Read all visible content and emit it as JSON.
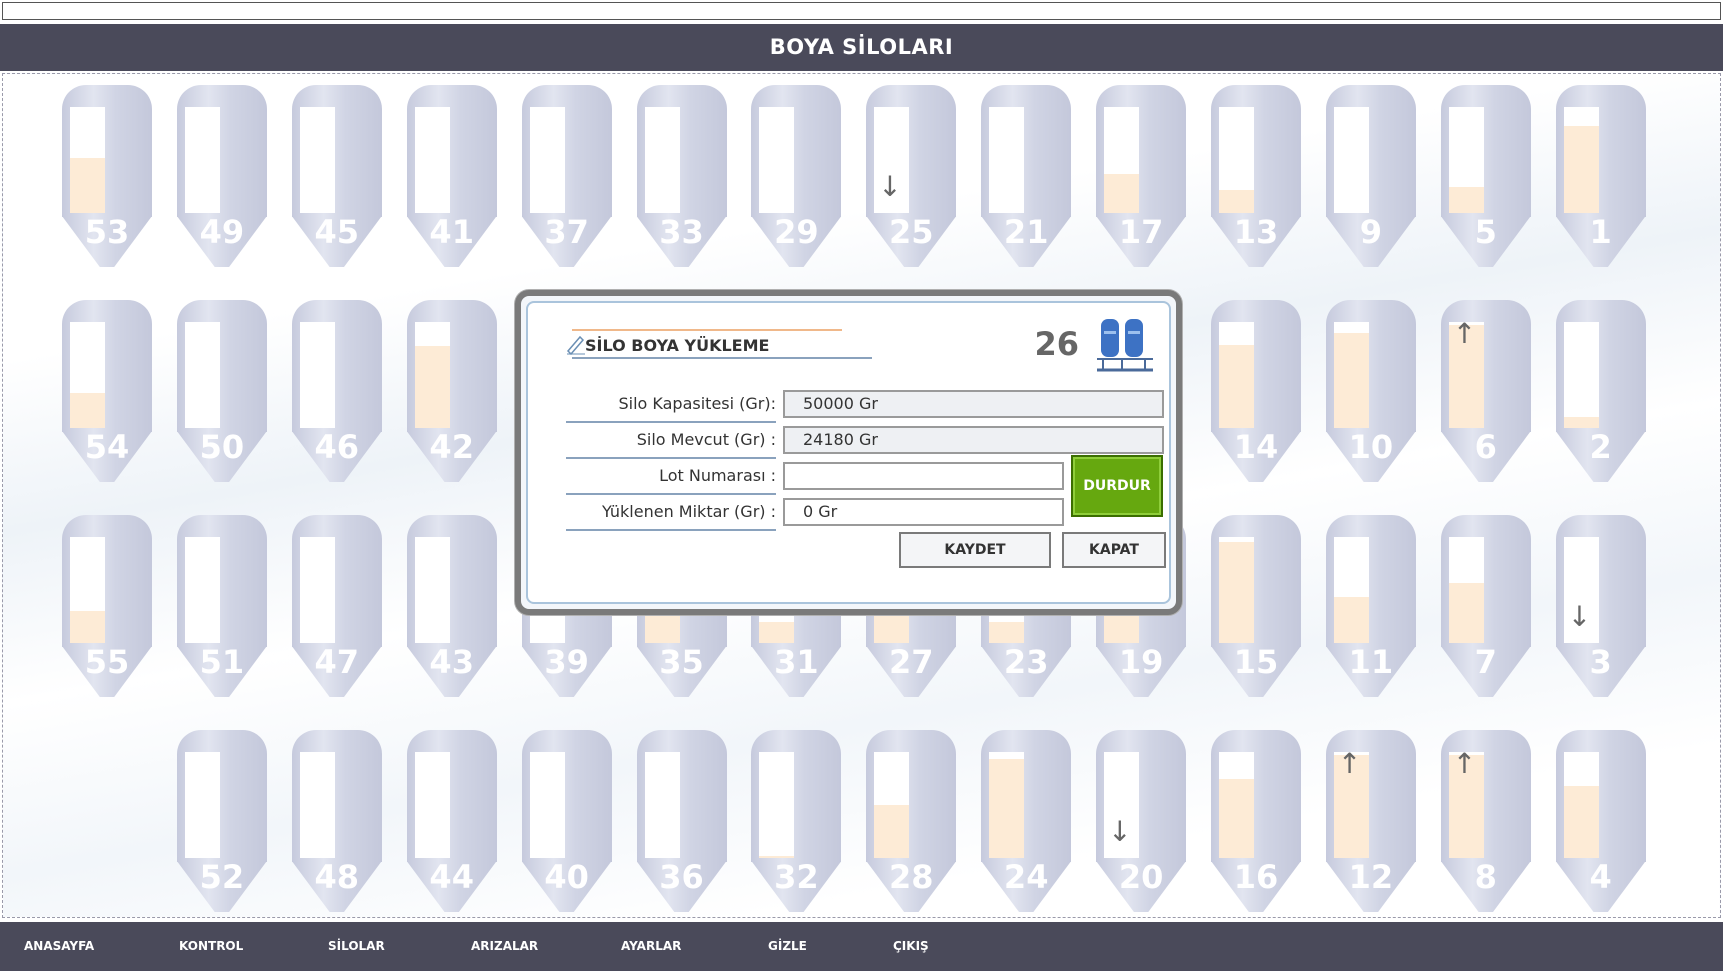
{
  "header": {
    "title": "BOYA SİLOLARI"
  },
  "silos": [
    {
      "num": "53",
      "fill": 0.52,
      "col": 0,
      "row": 0
    },
    {
      "num": "49",
      "fill": 0,
      "col": 1,
      "row": 0
    },
    {
      "num": "45",
      "fill": 0,
      "col": 2,
      "row": 0
    },
    {
      "num": "41",
      "fill": 0,
      "col": 3,
      "row": 0
    },
    {
      "num": "37",
      "fill": 0,
      "col": 4,
      "row": 0
    },
    {
      "num": "33",
      "fill": 0,
      "col": 5,
      "row": 0
    },
    {
      "num": "29",
      "fill": 0,
      "col": 6,
      "row": 0
    },
    {
      "num": "25",
      "fill": 0,
      "col": 7,
      "row": 0,
      "arrow": "down"
    },
    {
      "num": "21",
      "fill": 0,
      "col": 8,
      "row": 0
    },
    {
      "num": "17",
      "fill": 0.37,
      "col": 9,
      "row": 0
    },
    {
      "num": "13",
      "fill": 0.22,
      "col": 10,
      "row": 0
    },
    {
      "num": "9",
      "fill": 0,
      "col": 11,
      "row": 0
    },
    {
      "num": "5",
      "fill": 0.25,
      "col": 12,
      "row": 0
    },
    {
      "num": "1",
      "fill": 0.82,
      "col": 13,
      "row": 0
    },
    {
      "num": "54",
      "fill": 0.33,
      "col": 0,
      "row": 1
    },
    {
      "num": "50",
      "fill": 0,
      "col": 1,
      "row": 1
    },
    {
      "num": "46",
      "fill": 0,
      "col": 2,
      "row": 1
    },
    {
      "num": "42",
      "fill": 0.77,
      "col": 3,
      "row": 1
    },
    {
      "num": "14",
      "fill": 0.78,
      "col": 10,
      "row": 1
    },
    {
      "num": "10",
      "fill": 0.9,
      "col": 11,
      "row": 1
    },
    {
      "num": "6",
      "fill": 0.97,
      "col": 12,
      "row": 1,
      "arrow": "up"
    },
    {
      "num": "2",
      "fill": 0.1,
      "col": 13,
      "row": 1
    },
    {
      "num": "55",
      "fill": 0.3,
      "col": 0,
      "row": 2
    },
    {
      "num": "51",
      "fill": 0,
      "col": 1,
      "row": 2
    },
    {
      "num": "47",
      "fill": 0,
      "col": 2,
      "row": 2
    },
    {
      "num": "43",
      "fill": 0,
      "col": 3,
      "row": 2
    },
    {
      "num": "39",
      "fill": 0,
      "col": 4,
      "row": 2
    },
    {
      "num": "35",
      "fill": 0.3,
      "col": 5,
      "row": 2
    },
    {
      "num": "31",
      "fill": 0.2,
      "col": 6,
      "row": 2
    },
    {
      "num": "27",
      "fill": 0.3,
      "col": 7,
      "row": 2
    },
    {
      "num": "23",
      "fill": 0.2,
      "col": 8,
      "row": 2
    },
    {
      "num": "19",
      "fill": 0.3,
      "col": 9,
      "row": 2
    },
    {
      "num": "15",
      "fill": 0.95,
      "col": 10,
      "row": 2
    },
    {
      "num": "11",
      "fill": 0.43,
      "col": 11,
      "row": 2
    },
    {
      "num": "7",
      "fill": 0.57,
      "col": 12,
      "row": 2
    },
    {
      "num": "3",
      "fill": 0,
      "col": 13,
      "row": 2,
      "arrow": "down"
    },
    {
      "num": "52",
      "fill": 0,
      "col": 1,
      "row": 3
    },
    {
      "num": "48",
      "fill": 0,
      "col": 2,
      "row": 3
    },
    {
      "num": "44",
      "fill": 0,
      "col": 3,
      "row": 3
    },
    {
      "num": "40",
      "fill": 0,
      "col": 4,
      "row": 3
    },
    {
      "num": "36",
      "fill": 0,
      "col": 5,
      "row": 3
    },
    {
      "num": "32",
      "fill": 0.02,
      "col": 6,
      "row": 3
    },
    {
      "num": "28",
      "fill": 0.5,
      "col": 7,
      "row": 3
    },
    {
      "num": "24",
      "fill": 0.93,
      "col": 8,
      "row": 3
    },
    {
      "num": "20",
      "fill": 0,
      "col": 9,
      "row": 3,
      "arrow": "down"
    },
    {
      "num": "16",
      "fill": 0.75,
      "col": 10,
      "row": 3
    },
    {
      "num": "12",
      "fill": 0.97,
      "col": 11,
      "row": 3,
      "arrow": "up"
    },
    {
      "num": "8",
      "fill": 0.97,
      "col": 12,
      "row": 3,
      "arrow": "up"
    },
    {
      "num": "4",
      "fill": 0.68,
      "col": 13,
      "row": 3
    }
  ],
  "dialog": {
    "title": "SİLO BOYA YÜKLEME",
    "silo_number": "26",
    "capacity_label": "Silo Kapasitesi  (Gr):",
    "capacity_value": "50000  Gr",
    "current_label": "Silo Mevcut  (Gr) :",
    "current_value": "24180  Gr",
    "lot_label": "Lot Numarası :",
    "lot_value": "",
    "loaded_label": "Yüklenen Miktar  (Gr) :",
    "loaded_value": "0  Gr",
    "stop_label": "DURDUR",
    "save_label": "KAYDET",
    "close_label": "KAPAT"
  },
  "footer": {
    "items": [
      "ANASAYFA",
      "KONTROL",
      "SİLOLAR",
      "ARIZALAR",
      "AYARLAR",
      "GİZLE",
      "ÇIKIŞ"
    ]
  },
  "colors": {
    "header_bg": "#4a4a5a",
    "fill": "#fdebd6",
    "stop_button": "#66a80f"
  },
  "icons": {
    "pen": "pen-icon",
    "silo": "silo-pair-icon",
    "arrow_up": "arrow-up-icon",
    "arrow_down": "arrow-down-icon"
  }
}
